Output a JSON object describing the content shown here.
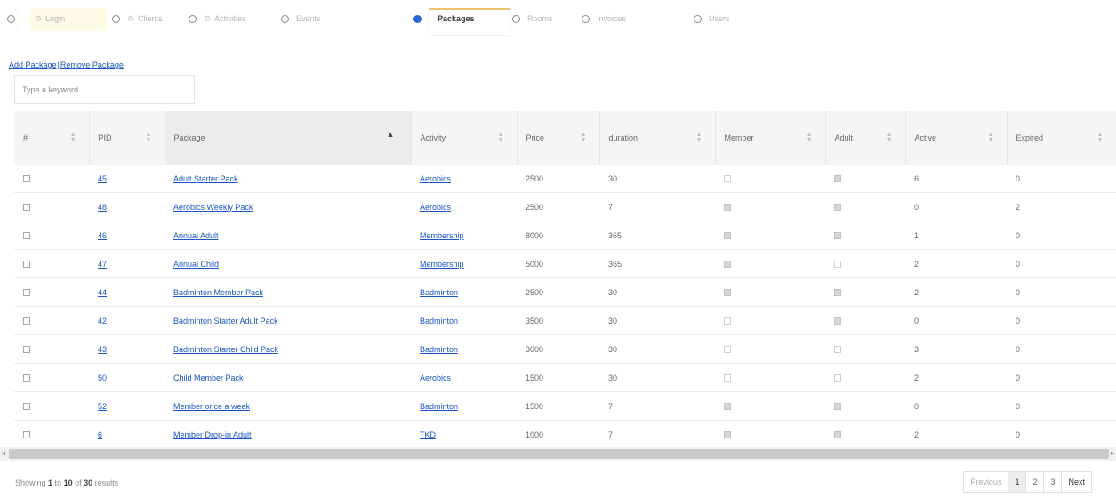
{
  "nav": {
    "items": [
      {
        "label": "Login",
        "icon": "gear-icon"
      },
      {
        "label": "Clients",
        "icon": "gear-icon"
      },
      {
        "label": "Activities",
        "icon": "gear-icon"
      },
      {
        "label": "Events",
        "icon": ""
      },
      {
        "label": "Packages",
        "icon": ""
      },
      {
        "label": "Rooms",
        "icon": ""
      },
      {
        "label": "Invoices",
        "icon": ""
      },
      {
        "label": "Users",
        "icon": ""
      }
    ],
    "active": "Packages"
  },
  "actions": {
    "add_label": "Add Package",
    "separator": "|",
    "remove_label": "Remove Package"
  },
  "search": {
    "placeholder": "Type a keyword ."
  },
  "table": {
    "columns": [
      "#",
      "PID",
      "Package",
      "Activity",
      "Price",
      "duration",
      "Member",
      "Adult",
      "Active",
      "Expired"
    ],
    "rows": [
      {
        "pid": "45",
        "package": "Adult Starter Pack",
        "activity": "Aerobics",
        "price": "2500",
        "duration": "30",
        "member": false,
        "adult": true,
        "active": "6",
        "expired": "0"
      },
      {
        "pid": "48",
        "package": "Aerobics Weekly Pack",
        "activity": "Aerobics",
        "price": "2500",
        "duration": "7",
        "member": true,
        "adult": true,
        "active": "0",
        "expired": "2"
      },
      {
        "pid": "46",
        "package": "Annual Adult",
        "activity": "Membership",
        "price": "8000",
        "duration": "365",
        "member": true,
        "adult": true,
        "active": "1",
        "expired": "0"
      },
      {
        "pid": "47",
        "package": "Annual Child",
        "activity": "Membership",
        "price": "5000",
        "duration": "365",
        "member": true,
        "adult": false,
        "active": "2",
        "expired": "0"
      },
      {
        "pid": "44",
        "package": "Badminton Member Pack",
        "activity": "Badminton",
        "price": "2500",
        "duration": "30",
        "member": true,
        "adult": true,
        "active": "2",
        "expired": "0"
      },
      {
        "pid": "42",
        "package": "Badminton Starter Adult Pack",
        "activity": "Badminton",
        "price": "3500",
        "duration": "30",
        "member": false,
        "adult": true,
        "active": "0",
        "expired": "0"
      },
      {
        "pid": "43",
        "package": "Badminton Starter Child Pack",
        "activity": "Badminton",
        "price": "3000",
        "duration": "30",
        "member": false,
        "adult": false,
        "active": "3",
        "expired": "0"
      },
      {
        "pid": "50",
        "package": "Child Member Pack",
        "activity": "Aerobics",
        "price": "1500",
        "duration": "30",
        "member": false,
        "adult": false,
        "active": "2",
        "expired": "0"
      },
      {
        "pid": "52",
        "package": "Member once a week",
        "activity": "Badminton",
        "price": "1500",
        "duration": "7",
        "member": true,
        "adult": true,
        "active": "0",
        "expired": "0"
      },
      {
        "pid": "6",
        "package": "Member Drop-in Adult",
        "activity": "TKD",
        "price": "1000",
        "duration": "7",
        "member": true,
        "adult": true,
        "active": "2",
        "expired": "0"
      }
    ]
  },
  "footer": {
    "showing_prefix": "Showing ",
    "from": "1",
    "to_word": " to ",
    "to": "10",
    "of_word": " of ",
    "total": "30",
    "suffix": " results"
  },
  "pager": {
    "previous": "Previous",
    "pages": [
      "1",
      "2",
      "3"
    ],
    "next": "Next",
    "current": "1"
  }
}
